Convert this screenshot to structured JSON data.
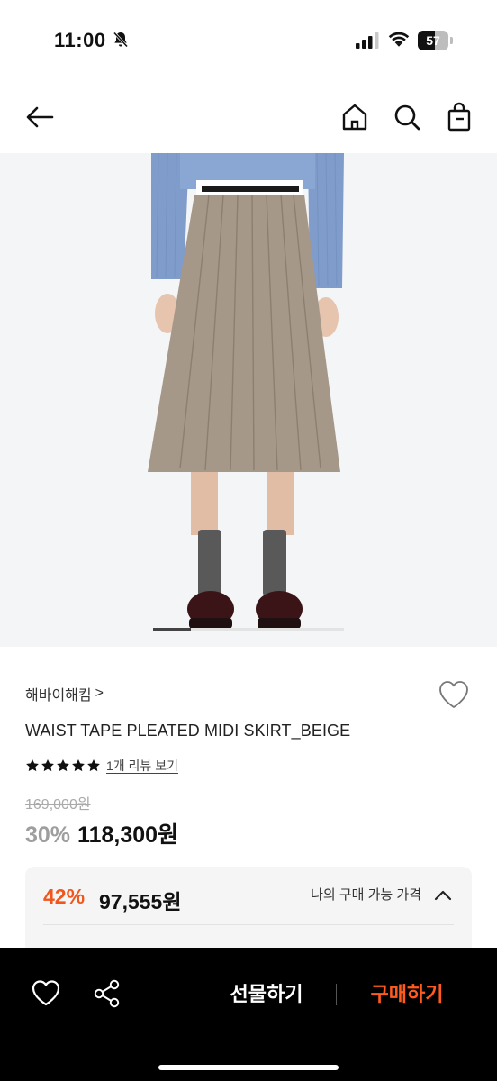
{
  "status_bar": {
    "time": "11:00",
    "battery": "57",
    "battery_level_percent": 57
  },
  "header": {
    "back_icon": "arrow-left-icon",
    "home_icon": "home-icon",
    "search_icon": "search-icon",
    "cart_icon": "shopping-bag-icon"
  },
  "gallery": {
    "current_position_fraction": 0.2
  },
  "product": {
    "brand": "해바이해킴",
    "brand_chevron": ">",
    "name": "WAIST TAPE PLEATED MIDI SKIRT_BEIGE",
    "rating_stars": 5,
    "review_link": "1개 리뷰 보기",
    "original_price": "169,000원",
    "discount_rate": "30%",
    "sale_price": "118,300원"
  },
  "member_price": {
    "rate": "42%",
    "price": "97,555원",
    "toggle_label": "나의 구매 가능 가격"
  },
  "bottom_bar": {
    "wish_icon": "heart-icon",
    "share_icon": "share-icon",
    "gift_label": "선물하기",
    "buy_label": "구매하기"
  },
  "colors": {
    "accent": "#ff5a1f",
    "member_rate": "#f0561e",
    "bottom_bar_bg": "#000000"
  }
}
